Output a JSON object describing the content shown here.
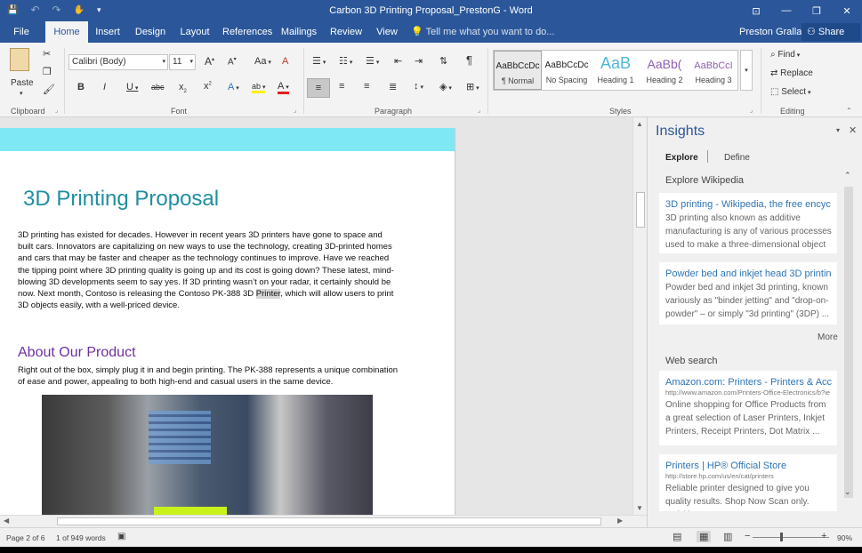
{
  "window": {
    "title": "Carbon 3D Printing Proposal_PrestonG - Word",
    "controls": [
      "⊡",
      "—",
      "❐",
      "✕"
    ]
  },
  "qat": {
    "save": "💾",
    "undo": "↶",
    "redo": "↷",
    "touch": "✋",
    "customize": "▾"
  },
  "tabs": [
    "File",
    "Home",
    "Insert",
    "Design",
    "Layout",
    "References",
    "Mailings",
    "Review",
    "View"
  ],
  "tell_me": "Tell me what you want to do...",
  "user_name": "Preston Gralla",
  "share_label": "Share",
  "ribbon": {
    "clipboard": {
      "label": "Clipboard",
      "paste": "Paste"
    },
    "font": {
      "label": "Font",
      "font_name": "Calibri (Body)",
      "font_size": "11",
      "grow": "A",
      "shrink": "A",
      "case": "Aa",
      "clear": "A",
      "bold": "B",
      "italic": "I",
      "underline": "U",
      "strike": "abc",
      "sub": "x",
      "sup": "x",
      "effects": "A",
      "highlight": "ab",
      "color": "A"
    },
    "paragraph": {
      "label": "Paragraph",
      "pilcrow": "¶"
    },
    "styles": {
      "label": "Styles",
      "items": [
        {
          "sample": "AaBbCcDc",
          "name": "¶ Normal"
        },
        {
          "sample": "AaBbCcDc",
          "name": "No Spacing"
        },
        {
          "sample": "AaB",
          "name": "Heading 1"
        },
        {
          "sample": "AaBb(",
          "name": "Heading 2"
        },
        {
          "sample": "AaBbCcI",
          "name": "Heading 3"
        }
      ]
    },
    "editing": {
      "label": "Editing",
      "find": "Find",
      "replace": "Replace",
      "select": "Select"
    }
  },
  "document": {
    "title": "3D Printing Proposal",
    "para1_before": "3D printing has existed for decades. However in recent years 3D printers have gone to space and built cars. Innovators are capitalizing on new ways to use the technology, creating 3D-printed homes and cars that may be faster and cheaper as the technology continues to improve. Have we reached the tipping point where 3D printing quality is going up and its cost is going down? These latest, mind-blowing 3D developments seem to say yes. If 3D printing wasn’t on your radar, it certainly should be now. Next month, Contoso is releasing the Contoso PK-388 3D ",
    "para1_highlight": "Printer",
    "para1_after": ", which will allow users to print 3D objects easily, with a well-priced device.",
    "heading2": "About Our Product",
    "para2": "Right out of the box, simply plug it in and begin printing. The PK-388 represents a unique combination of ease and power, appealing to both high-end and casual users in the same device."
  },
  "insights": {
    "title": "Insights",
    "tabs": {
      "explore": "Explore",
      "define": "Define"
    },
    "wikipedia_label": "Explore Wikipedia",
    "wiki_cards": [
      {
        "title": "3D printing - Wikipedia, the free encyc",
        "desc": "3D printing also known as additive manufacturing is any of various processes used to make a three-dimensional object ..."
      },
      {
        "title": "Powder bed and inkjet head 3D printin",
        "desc": "Powder bed and inkjet 3d printing, known variously as \"binder jetting\" and \"drop-on-powder\" – or simply \"3d printing\" (3DP) ..."
      }
    ],
    "more": "More",
    "web_label": "Web search",
    "web_cards": [
      {
        "title": "Amazon.com: Printers - Printers & Acce",
        "url": "http://www.amazon.com/Printers-Office-Electronics/b?ie",
        "desc": "Online shopping for Office Products from a great selection of Laser Printers, Inkjet Printers, Receipt Printers, Dot Matrix ..."
      },
      {
        "title": "Printers | HP® Official Store",
        "url": "http://store.hp.com/us/en/cat/printers",
        "desc": "Reliable printer designed to give you quality results. Shop Now Scan only. Quickly scan a"
      }
    ]
  },
  "status": {
    "page": "Page 2 of 6",
    "words": "1 of 949 words",
    "zoom": "90%"
  }
}
